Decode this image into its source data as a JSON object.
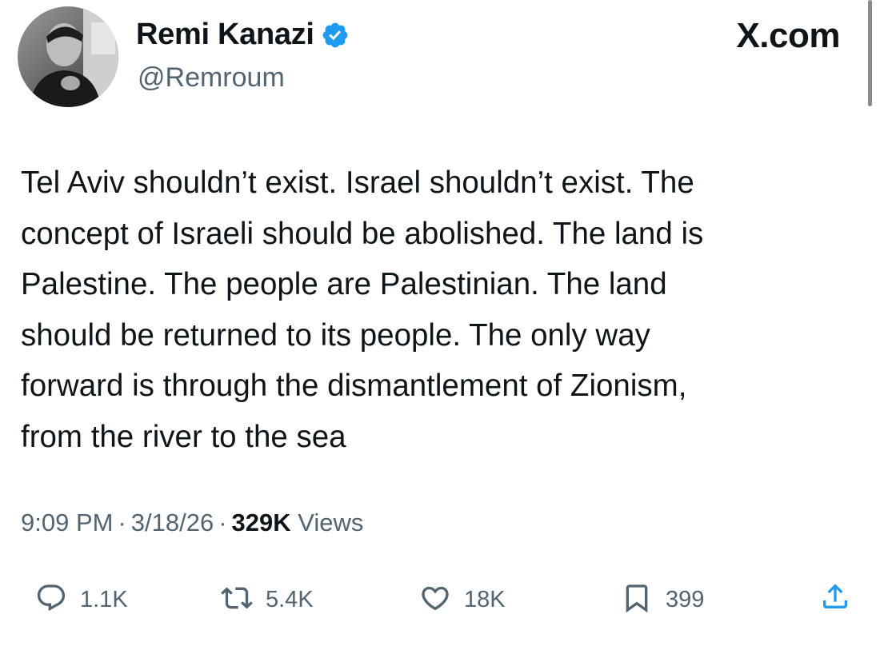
{
  "header": {
    "display_name": "Remi Kanazi",
    "handle": "@Remroum",
    "brand": "X.com",
    "avatar_icon": "user-avatar-photo",
    "verified_icon": "verified-badge-icon",
    "verified_color": "#1d9bf0"
  },
  "tweet": {
    "text_lines": [
      "Tel Aviv shouldn’t exist. Israel shouldn’t exist. The",
      "concept of Israeli should be abolished. The land is",
      "Palestine. The people are Palestinian. The land",
      "should be returned to its people. The only way",
      "forward is through the dismantlement of Zionism,",
      "from the river to the sea"
    ]
  },
  "meta": {
    "time": "9:09 PM",
    "separator": "·",
    "date": "3/18/26",
    "views_count": "329K",
    "views_label": "Views"
  },
  "actions": {
    "reply": {
      "icon": "reply-icon",
      "count": "1.1K"
    },
    "retweet": {
      "icon": "retweet-icon",
      "count": "5.4K"
    },
    "like": {
      "icon": "heart-icon",
      "count": "18K"
    },
    "bookmark": {
      "icon": "bookmark-icon",
      "count": "399"
    },
    "share": {
      "icon": "share-icon"
    }
  },
  "colors": {
    "text": "#0f1419",
    "secondary": "#536471",
    "accent": "#1d9bf0"
  }
}
